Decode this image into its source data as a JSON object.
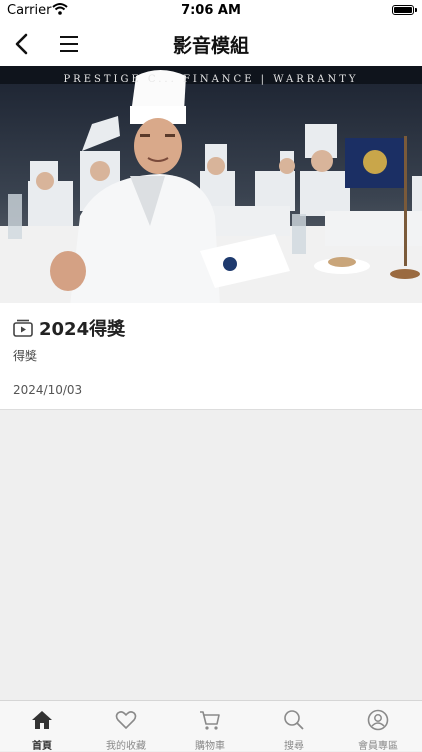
{
  "status_bar": {
    "carrier": "Carrier",
    "time": "7:06 AM"
  },
  "nav": {
    "title": "影音模組",
    "back_icon": "chevron-left-icon",
    "menu_icon": "hamburger-menu-icon"
  },
  "hero": {
    "banner_text": "PRESTIGE C... FINANCE | WARRANTY"
  },
  "card": {
    "title": "2024得獎",
    "subtitle": "得獎",
    "date": "2024/10/03",
    "icon": "video-play-icon"
  },
  "tabs": [
    {
      "label": "首頁",
      "icon": "home-icon",
      "active": true
    },
    {
      "label": "我的收藏",
      "icon": "heart-icon",
      "active": false
    },
    {
      "label": "購物車",
      "icon": "cart-icon",
      "active": false
    },
    {
      "label": "搜尋",
      "icon": "search-icon",
      "active": false
    },
    {
      "label": "會員專區",
      "icon": "user-icon",
      "active": false
    }
  ],
  "colors": {
    "background": "#efefef",
    "active_tab": "#333333",
    "inactive_tab": "#8a8a8a"
  }
}
